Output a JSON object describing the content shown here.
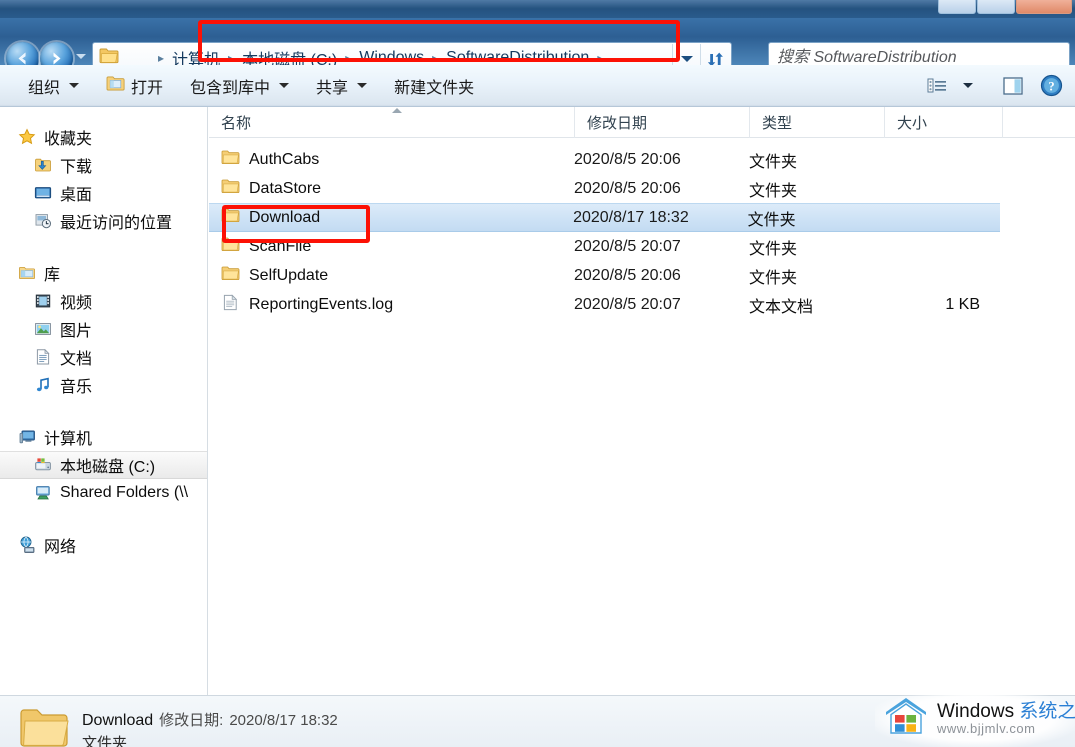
{
  "window": {
    "controls": [
      "minimize",
      "maximize",
      "close"
    ]
  },
  "address": {
    "folder_icon": "folder-icon",
    "back_icon": "back-arrow-icon",
    "forward_icon": "forward-arrow-icon",
    "recent_locations_icon": "chevron-down-icon",
    "dropdown_icon": "chevron-down-icon",
    "refresh_icon": "refresh-icon",
    "breadcrumbs": [
      {
        "label": "计算机"
      },
      {
        "label": "本地磁盘 (C:)"
      },
      {
        "label": "Windows"
      },
      {
        "label": "SoftwareDistribution"
      }
    ],
    "separator": "▸"
  },
  "search": {
    "placeholder": "搜索 SoftwareDistribution",
    "value": "",
    "icon": "search-icon"
  },
  "toolbar": {
    "items": [
      {
        "label": "组织",
        "icon": "",
        "caret": true
      },
      {
        "label": "打开",
        "icon": "open-folder-icon",
        "caret": false
      },
      {
        "label": "包含到库中",
        "icon": "",
        "caret": true
      },
      {
        "label": "共享",
        "icon": "",
        "caret": true
      },
      {
        "label": "新建文件夹",
        "icon": "",
        "caret": false
      }
    ],
    "view_icon": "view-options-icon",
    "view_caret_icon": "chevron-down-icon",
    "preview_icon": "preview-pane-icon",
    "help_icon": "help-icon"
  },
  "sidebar": {
    "groups": [
      {
        "header": {
          "label": "收藏夹",
          "icon": "favorites-star-icon"
        },
        "items": [
          {
            "label": "下载",
            "icon": "downloads-icon"
          },
          {
            "label": "桌面",
            "icon": "desktop-icon"
          },
          {
            "label": "最近访问的位置",
            "icon": "recent-places-icon"
          }
        ]
      },
      {
        "header": {
          "label": "库",
          "icon": "library-icon"
        },
        "items": [
          {
            "label": "视频",
            "icon": "videos-icon"
          },
          {
            "label": "图片",
            "icon": "pictures-icon"
          },
          {
            "label": "文档",
            "icon": "documents-icon"
          },
          {
            "label": "音乐",
            "icon": "music-icon"
          }
        ]
      },
      {
        "header": {
          "label": "计算机",
          "icon": "computer-icon"
        },
        "items": [
          {
            "label": "本地磁盘 (C:)",
            "icon": "local-disk-icon",
            "selected": true
          },
          {
            "label": "Shared Folders (\\\\",
            "icon": "shared-folder-icon",
            "selected": false
          }
        ]
      },
      {
        "header": {
          "label": "网络",
          "icon": "network-icon"
        },
        "items": []
      }
    ]
  },
  "filelist": {
    "columns": [
      {
        "key": "name",
        "label": "名称",
        "sorted": "asc"
      },
      {
        "key": "date",
        "label": "修改日期",
        "sorted": ""
      },
      {
        "key": "type",
        "label": "类型",
        "sorted": ""
      },
      {
        "key": "size",
        "label": "大小",
        "sorted": ""
      }
    ],
    "rows": [
      {
        "name": "AuthCabs",
        "date": "2020/8/5 20:06",
        "type": "文件夹",
        "size": "",
        "icon": "folder-icon",
        "selected": false
      },
      {
        "name": "DataStore",
        "date": "2020/8/5 20:06",
        "type": "文件夹",
        "size": "",
        "icon": "folder-icon",
        "selected": false
      },
      {
        "name": "Download",
        "date": "2020/8/17 18:32",
        "type": "文件夹",
        "size": "",
        "icon": "folder-icon",
        "selected": true
      },
      {
        "name": "ScanFile",
        "date": "2020/8/5 20:07",
        "type": "文件夹",
        "size": "",
        "icon": "folder-icon",
        "selected": false
      },
      {
        "name": "SelfUpdate",
        "date": "2020/8/5 20:06",
        "type": "文件夹",
        "size": "",
        "icon": "folder-icon",
        "selected": false
      },
      {
        "name": "ReportingEvents.log",
        "date": "2020/8/5 20:07",
        "type": "文本文档",
        "size": "1 KB",
        "icon": "log-file-icon",
        "selected": false
      }
    ]
  },
  "statusbar": {
    "icon": "folder-icon-large",
    "name": "Download",
    "meta_label": "修改日期:",
    "meta_value": "2020/8/17 18:32",
    "type": "文件夹"
  },
  "watermark": {
    "brand": "Windows",
    "brand_cn": "系统之家",
    "url": "www.bjjmlv.com",
    "logo": "house-windows-logo-icon"
  },
  "annotations": [
    {
      "name": "address-bar-highlight",
      "color": "#fc1105"
    },
    {
      "name": "download-row-highlight",
      "color": "#fc1105"
    }
  ]
}
